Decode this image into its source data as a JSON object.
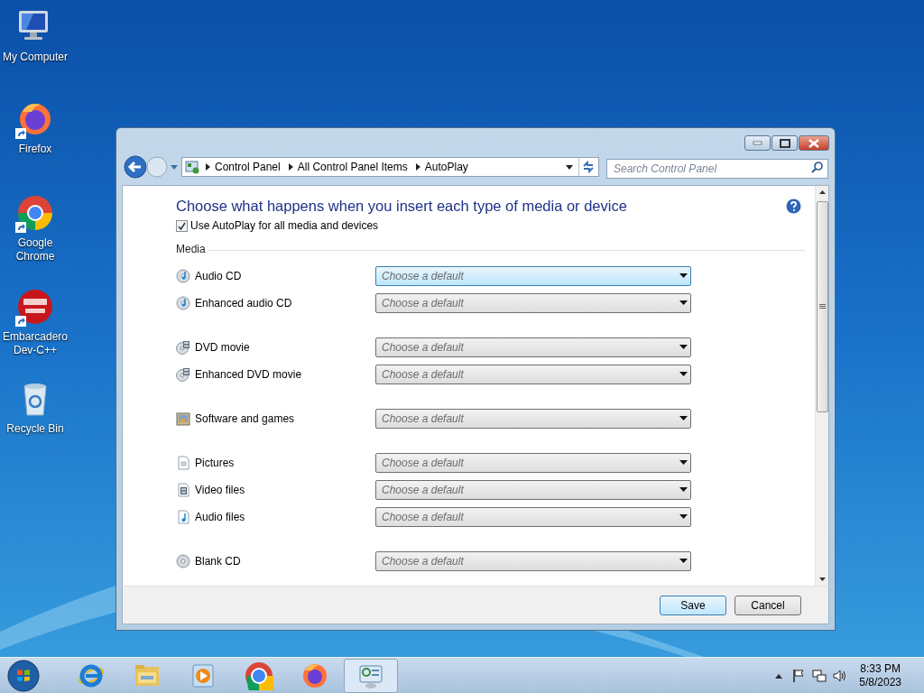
{
  "desktop_icons": [
    {
      "kind": "computer",
      "label": "My Computer",
      "shortcut": false
    },
    {
      "kind": "firefox",
      "label": "Firefox",
      "shortcut": true
    },
    {
      "kind": "chrome",
      "label": "Google Chrome",
      "shortcut": true
    },
    {
      "kind": "devcpp",
      "label": "Embarcadero Dev-C++",
      "shortcut": true
    },
    {
      "kind": "recycle",
      "label": "Recycle Bin",
      "shortcut": false
    }
  ],
  "window": {
    "breadcrumb": [
      "Control Panel",
      "All Control Panel Items",
      "AutoPlay"
    ],
    "search": {
      "placeholder": "Search Control Panel"
    },
    "heading": "Choose what happens when you insert each type of media or device",
    "autoplay_checkbox": {
      "label": "Use AutoPlay for all media and devices",
      "checked": true
    },
    "section": "Media",
    "media_groups": [
      [
        {
          "kind": "audio-disc",
          "label": "Audio CD",
          "value": "Choose a default",
          "highlighted": true
        },
        {
          "kind": "audio-disc",
          "label": "Enhanced audio CD",
          "value": "Choose a default",
          "highlighted": false
        }
      ],
      [
        {
          "kind": "dvd-disc",
          "label": "DVD movie",
          "value": "Choose a default",
          "highlighted": false
        },
        {
          "kind": "dvd-disc",
          "label": "Enhanced DVD movie",
          "value": "Choose a default",
          "highlighted": false
        }
      ],
      [
        {
          "kind": "software",
          "label": "Software and games",
          "value": "Choose a default",
          "highlighted": false
        }
      ],
      [
        {
          "kind": "picture-file",
          "label": "Pictures",
          "value": "Choose a default",
          "highlighted": false
        },
        {
          "kind": "video-file",
          "label": "Video files",
          "value": "Choose a default",
          "highlighted": false
        },
        {
          "kind": "audio-file",
          "label": "Audio files",
          "value": "Choose a default",
          "highlighted": false
        }
      ],
      [
        {
          "kind": "blank-disc",
          "label": "Blank CD",
          "value": "Choose a default",
          "highlighted": false
        }
      ]
    ],
    "buttons": [
      {
        "label": "Save",
        "default": true
      },
      {
        "label": "Cancel",
        "default": false
      }
    ]
  },
  "taskbar": {
    "apps": [
      {
        "kind": "ie",
        "active": false
      },
      {
        "kind": "explorer",
        "active": false
      },
      {
        "kind": "media",
        "active": false
      },
      {
        "kind": "chrome",
        "active": false
      },
      {
        "kind": "firefox",
        "active": false
      },
      {
        "kind": "control-panel",
        "active": true
      }
    ],
    "time": "8:33 PM",
    "date": "5/8/2023"
  }
}
